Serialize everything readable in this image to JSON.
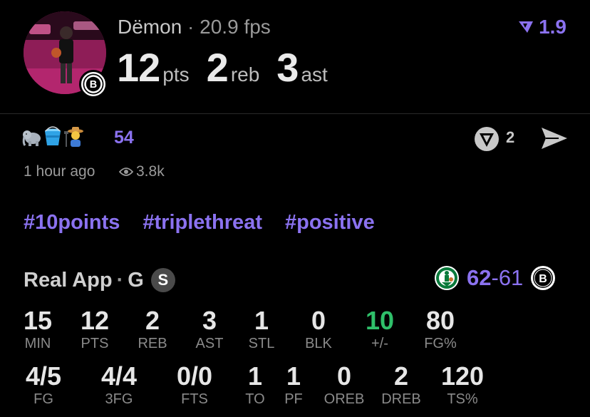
{
  "header": {
    "player_name": "Dëmon",
    "separator": "·",
    "fps": "20.9 fps",
    "rating": "1.9",
    "stats": [
      {
        "value": "12",
        "label": "pts"
      },
      {
        "value": "2",
        "label": "reb"
      },
      {
        "value": "3",
        "label": "ast"
      }
    ]
  },
  "post": {
    "reaction_icons": [
      "elephant-icon",
      "bucket-icon",
      "farmer-icon"
    ],
    "reaction_count": "54",
    "time_ago": "1 hour ago",
    "views": "3.8k",
    "comment_count": "2",
    "hashtags": [
      "#10points",
      "#triplethreat",
      "#positive"
    ]
  },
  "game": {
    "source": "Real App",
    "separator": "·",
    "position": "G",
    "badge": "S",
    "home_score": "62",
    "dash": "-",
    "away_score": "61"
  },
  "boxscore_row1": [
    {
      "value": "15",
      "label": "MIN"
    },
    {
      "value": "12",
      "label": "PTS"
    },
    {
      "value": "2",
      "label": "REB"
    },
    {
      "value": "3",
      "label": "AST"
    },
    {
      "value": "1",
      "label": "STL"
    },
    {
      "value": "0",
      "label": "BLK"
    },
    {
      "value": "10",
      "label": "+/-"
    },
    {
      "value": "80",
      "label": "FG%"
    }
  ],
  "boxscore_row2": [
    {
      "value": "4/5",
      "label": "FG"
    },
    {
      "value": "4/4",
      "label": "3FG"
    },
    {
      "value": "0/0",
      "label": "FTS"
    },
    {
      "value": "1",
      "label": "TO"
    },
    {
      "value": "1",
      "label": "PF"
    },
    {
      "value": "0",
      "label": "OREB"
    },
    {
      "value": "2",
      "label": "DREB"
    },
    {
      "value": "120",
      "label": "TS%"
    }
  ],
  "colors": {
    "accent": "#8b72f0",
    "positive": "#2fc06a",
    "background": "#000000",
    "celtics_green": "#0a7a3b"
  }
}
